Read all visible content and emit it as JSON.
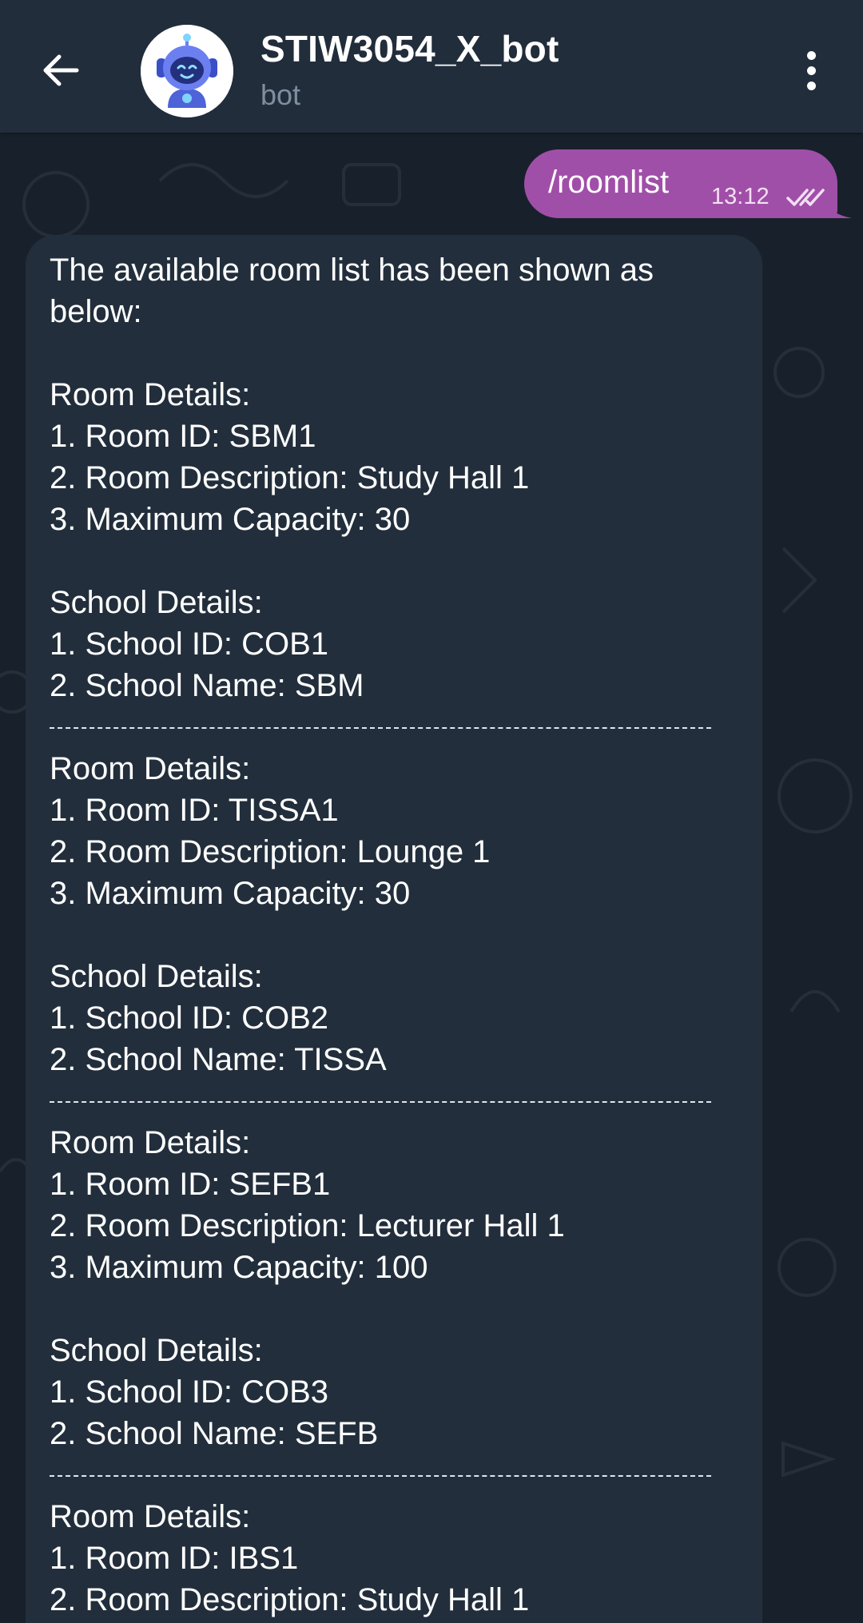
{
  "header": {
    "title": "STIW3054_X_bot",
    "subtitle": "bot",
    "back_icon": "arrow-left-icon",
    "menu_icon": "more-vertical-icon",
    "avatar_icon": "robot-avatar-icon"
  },
  "outgoing": {
    "text": "/roomlist",
    "time": "13:12",
    "status_icon": "double-check-icon",
    "color": "#a04fa8"
  },
  "incoming": {
    "intro": [
      "The available room list has been shown as",
      "below:"
    ],
    "divider": "--------------------------------------------------------------------------------",
    "blocks": [
      {
        "room_header": "Room Details:",
        "room_id": "1. Room ID: SBM1",
        "room_desc": "2. Room Description: Study Hall 1",
        "room_cap": "3. Maximum Capacity: 30",
        "school_header": "School Details:",
        "school_id": "1. School ID: COB1",
        "school_name": "2. School Name: SBM"
      },
      {
        "room_header": "Room Details:",
        "room_id": "1. Room ID: TISSA1",
        "room_desc": "2. Room Description: Lounge 1",
        "room_cap": "3. Maximum Capacity: 30",
        "school_header": "School Details:",
        "school_id": "1. School ID: COB2",
        "school_name": "2. School Name: TISSA"
      },
      {
        "room_header": "Room Details:",
        "room_id": "1. Room ID: SEFB1",
        "room_desc": "2. Room Description: Lecturer Hall 1",
        "room_cap": "3. Maximum Capacity: 100",
        "school_header": "School Details:",
        "school_id": "1. School ID: COB3",
        "school_name": "2. School Name: SEFB"
      },
      {
        "room_header": "Room Details:",
        "room_id": "1. Room ID: IBS1",
        "room_desc": "2. Room Description: Study Hall 1"
      }
    ]
  },
  "colors": {
    "header_bg": "#212d3b",
    "chat_bg": "#18212b",
    "incoming_bg": "#222e3b",
    "outgoing_bg": "#a04fa8"
  }
}
